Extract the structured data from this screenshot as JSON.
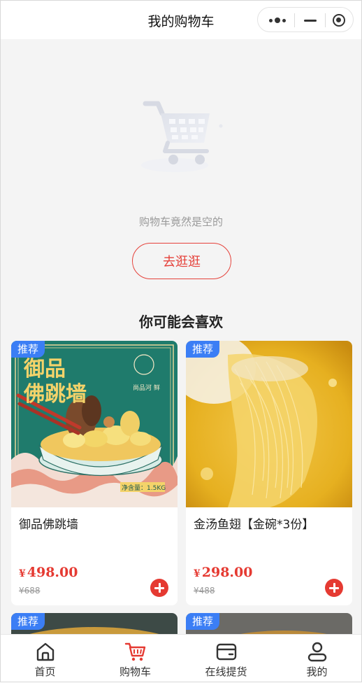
{
  "titlebar": {
    "title": "我的购物车",
    "capsule_icons": [
      "more-dots-icon",
      "minimize-icon",
      "close-target-icon"
    ]
  },
  "empty_cart": {
    "icon": "empty-cart-icon",
    "message": "购物车竟然是空的",
    "go_shopping_label": "去逛逛"
  },
  "recommend": {
    "title": "你可能会喜欢",
    "products": [
      {
        "badge": "推荐",
        "name": "御品佛跳墙",
        "price_symbol": "¥",
        "price": "498.00",
        "original_price": "¥688",
        "image_text": "御品佛跳墙",
        "image_seal": "尚品河 鲜",
        "image_net": "净含量：1.5KG"
      },
      {
        "badge": "推荐",
        "name": "金汤鱼翅【金碗*3份】",
        "price_symbol": "¥",
        "price": "298.00",
        "original_price": "¥488"
      },
      {
        "badge": "推荐"
      },
      {
        "badge": "推荐"
      }
    ]
  },
  "tabbar": {
    "items": [
      {
        "label": "首页",
        "icon": "home-icon",
        "active": false
      },
      {
        "label": "购物车",
        "icon": "cart-icon",
        "active": true
      },
      {
        "label": "在线提货",
        "icon": "wallet-icon",
        "active": false
      },
      {
        "label": "我的",
        "icon": "user-icon",
        "active": false
      }
    ]
  },
  "colors": {
    "accent_red": "#e5413a",
    "badge_blue": "#3b7ef5",
    "background": "#f4f4f4"
  }
}
